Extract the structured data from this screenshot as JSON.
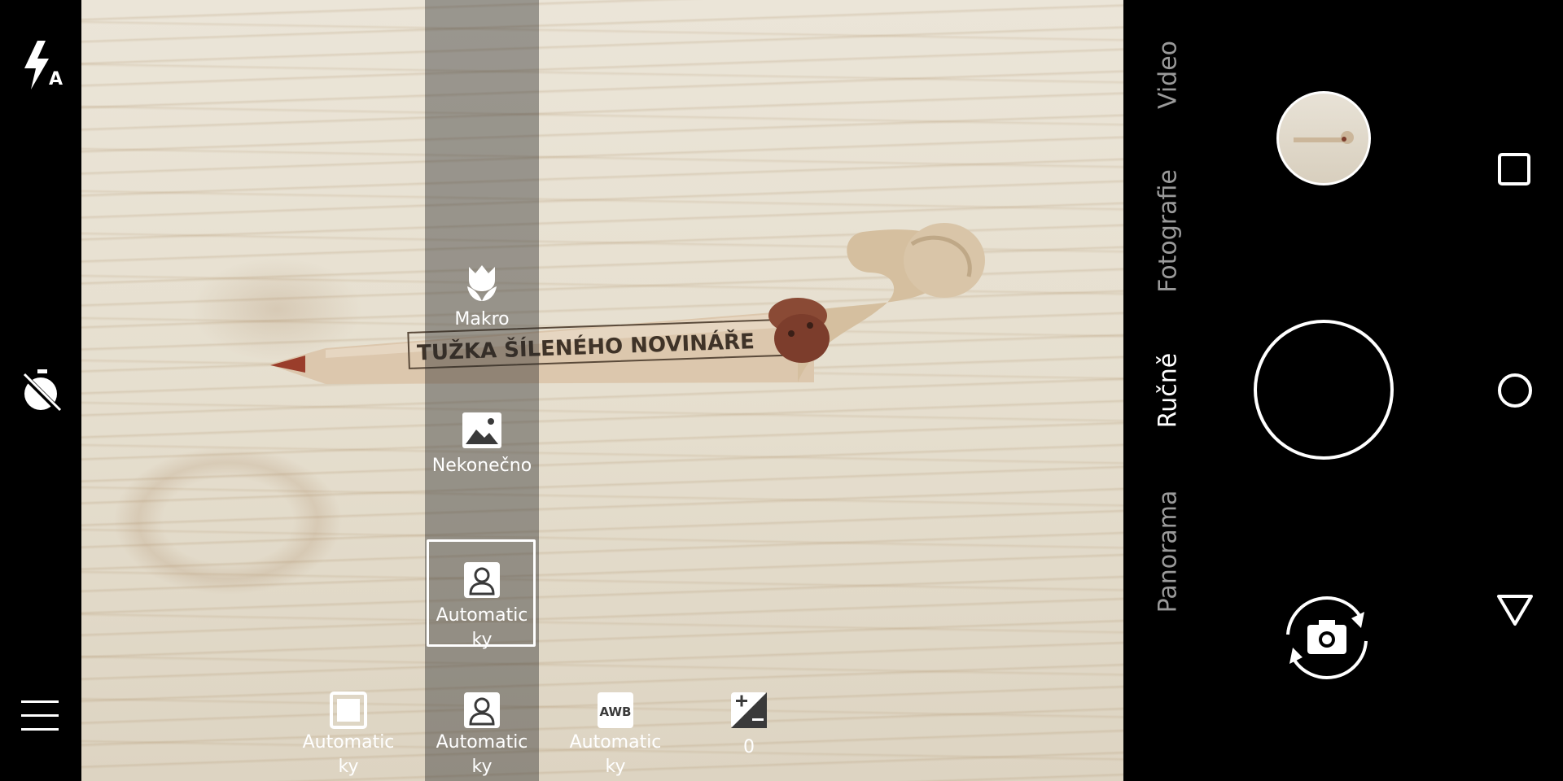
{
  "left_toolbar": {
    "flash_icon": "flash-auto-icon",
    "timer_icon": "timer-off-icon",
    "menu_icon": "hamburger-menu-icon"
  },
  "viewfinder": {
    "pencil_text": "TUŽKA ŠÍLENÉHO NOVINÁŘE"
  },
  "focus_options": [
    {
      "icon": "macro-tulip-icon",
      "label": "Makro"
    },
    {
      "icon": "landscape-icon",
      "label": "Nekonečno"
    },
    {
      "icon": "person-icon",
      "label": "Automatic\nky",
      "selected": true
    }
  ],
  "settings_row": [
    {
      "icon": "square-icon",
      "label": "Automatic\nky"
    },
    {
      "icon": "person-icon",
      "label": "Automatic\nky"
    },
    {
      "icon": "awb-icon",
      "label": "Automatic\nky"
    },
    {
      "icon": "exposure-icon",
      "label": "0"
    }
  ],
  "modes": [
    {
      "label": "Video",
      "active": false
    },
    {
      "label": "Fotografie",
      "active": false
    },
    {
      "label": "Ručně",
      "active": true
    },
    {
      "label": "Panorama",
      "active": false
    }
  ],
  "awb_text": "AWB",
  "colors": {
    "background": "#000000",
    "panel_overlay": "#282828",
    "text": "#ffffff",
    "inactive_mode": "#9a9a9a"
  }
}
